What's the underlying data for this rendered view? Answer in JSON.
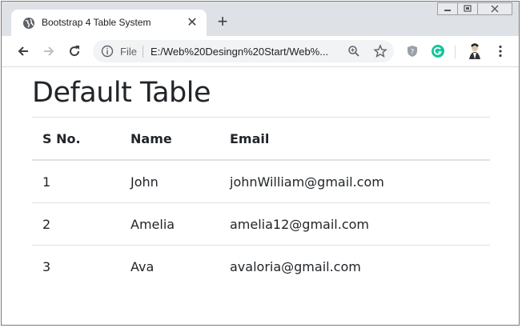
{
  "browser": {
    "tab_title": "Bootstrap 4 Table System",
    "tab_close": "✕",
    "new_tab": "+",
    "omnibox": {
      "scheme_label": "File",
      "url": "E:/Web%20Desingn%20Start/Web%..."
    }
  },
  "page": {
    "title": "Default Table",
    "table": {
      "headers": [
        "S No.",
        "Name",
        "Email"
      ],
      "rows": [
        [
          "1",
          "John",
          "johnWilliam@gmail.com"
        ],
        [
          "2",
          "Amelia",
          "amelia12@gmail.com"
        ],
        [
          "3",
          "Ava",
          "avaloria@gmail.com"
        ]
      ]
    }
  },
  "colors": {
    "titlebar": "#dee1e6",
    "accent_grammarly": "#15c39a",
    "text": "#212529",
    "border": "#dee2e6"
  }
}
